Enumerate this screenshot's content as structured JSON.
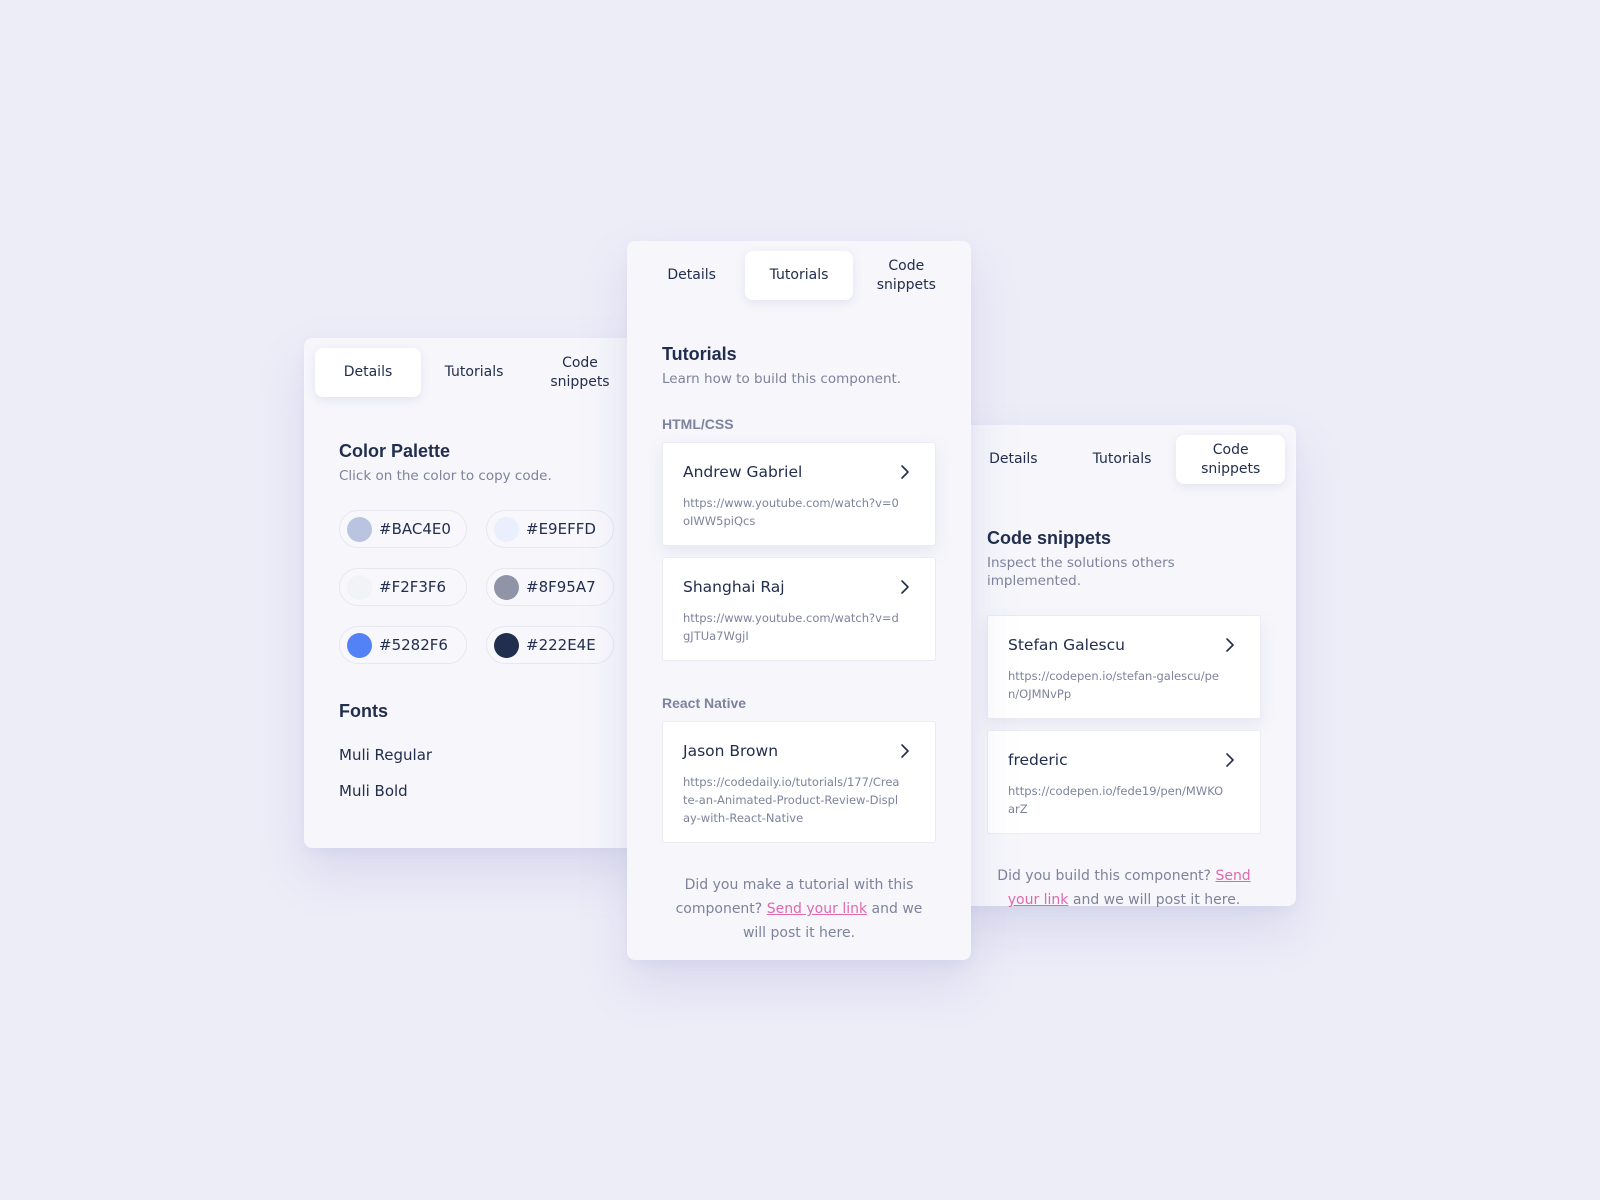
{
  "tabs": {
    "details": "Details",
    "tutorials": "Tutorials",
    "code_snippets": "Code snippets"
  },
  "details_card": {
    "title": "Color Palette",
    "subtitle": "Click on the color to copy code.",
    "colors": [
      {
        "code": "#BAC4E0",
        "hex": "#BAC4E0"
      },
      {
        "code": "#E9EFFD",
        "hex": "#E9EFFD"
      },
      {
        "code": "#F2F3F6",
        "hex": "#F2F3F6"
      },
      {
        "code": "#8F95A7",
        "hex": "#8F95A7"
      },
      {
        "code": "#5282F6",
        "hex": "#5282F6"
      },
      {
        "code": "#222E4E",
        "hex": "#222E4E"
      }
    ],
    "fonts_title": "Fonts",
    "fonts": [
      "Muli Regular",
      "Muli Bold"
    ]
  },
  "tutorials_card": {
    "title": "Tutorials",
    "subtitle": "Learn how to build this component.",
    "groups": [
      {
        "label": "HTML/CSS",
        "items": [
          {
            "name": "Andrew Gabriel",
            "url": "https://www.youtube.com/watch?v=0oIWW5piQcs"
          },
          {
            "name": "Shanghai Raj",
            "url": "https://www.youtube.com/watch?v=dgJTUa7WgjI"
          }
        ]
      },
      {
        "label": "React Native",
        "items": [
          {
            "name": "Jason Brown",
            "url": "https://codedaily.io/tutorials/177/Create-an-Animated-Product-Review-Display-with-React-Native"
          }
        ]
      }
    ],
    "footer_before": "Did you make a tutorial with this component?",
    "footer_link": "Send your link",
    "footer_after": "and we will post it here."
  },
  "snippets_card": {
    "title": "Code snippets",
    "subtitle": "Inspect the solutions others implemented.",
    "items": [
      {
        "name": "Stefan Galescu",
        "url": "https://codepen.io/stefan-galescu/pen/OJMNvPp"
      },
      {
        "name": "frederic",
        "url": "https://codepen.io/fede19/pen/MWKOarZ"
      }
    ],
    "footer_before": "Did you build this component?",
    "footer_link": "Send your link",
    "footer_after": "and we will post it here."
  },
  "icons": {
    "chevron": "chevron-right-icon"
  },
  "colors": {
    "background": "#EDEDF8",
    "card": "#F6F6FB",
    "text": "#222E4E",
    "muted": "#7E839D",
    "link": "#E069AE"
  }
}
